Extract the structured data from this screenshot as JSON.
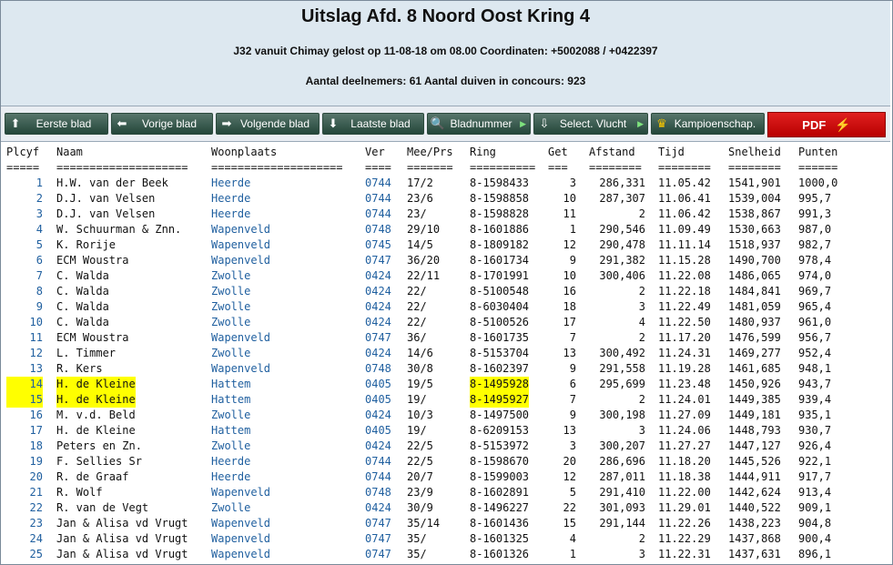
{
  "header": {
    "title": "Uitslag Afd. 8 Noord Oost Kring 4",
    "subtitle1": "J32 vanuit Chimay gelost op 11-08-18 om 08.00 Coordinaten: +5002088 / +0422397",
    "subtitle2": "Aantal deelnemers: 61 Aantal duiven in concours: 923"
  },
  "toolbar": {
    "first": "Eerste blad",
    "prev": "Vorige blad",
    "next": "Volgende blad",
    "last": "Laatste blad",
    "number": "Bladnummer",
    "select": "Select. Vlucht",
    "champ": "Kampioenschap.",
    "pdf": "PDF"
  },
  "table": {
    "headers": [
      "Plcyf",
      "Naam",
      "Woonplaats",
      "Ver",
      "Mee/Prs",
      "Ring",
      "Get",
      "Afstand",
      "Tijd",
      "Snelheid",
      "Punten"
    ],
    "underlines": [
      "=====",
      "====================",
      "====================",
      "====",
      "=======",
      "==========",
      "===",
      "========",
      "========",
      "========",
      "======"
    ],
    "rows": [
      [
        "1",
        "H.W. van der Beek",
        "Heerde",
        "0744",
        "17/2",
        "8-1598433",
        "3",
        "286,331",
        "11.05.42",
        "1541,901",
        "1000,0"
      ],
      [
        "2",
        "D.J. van Velsen",
        "Heerde",
        "0744",
        "23/6",
        "8-1598858",
        "10",
        "287,307",
        "11.06.41",
        "1539,004",
        "995,7"
      ],
      [
        "3",
        "D.J. van Velsen",
        "Heerde",
        "0744",
        "23/",
        "8-1598828",
        "11",
        "2",
        "11.06.42",
        "1538,867",
        "991,3"
      ],
      [
        "4",
        "W. Schuurman & Znn.",
        "Wapenveld",
        "0748",
        "29/10",
        "8-1601886",
        "1",
        "290,546",
        "11.09.49",
        "1530,663",
        "987,0"
      ],
      [
        "5",
        "K. Rorije",
        "Wapenveld",
        "0745",
        "14/5",
        "8-1809182",
        "12",
        "290,478",
        "11.11.14",
        "1518,937",
        "982,7"
      ],
      [
        "6",
        "ECM Woustra",
        "Wapenveld",
        "0747",
        "36/20",
        "8-1601734",
        "9",
        "291,382",
        "11.15.28",
        "1490,700",
        "978,4"
      ],
      [
        "7",
        "C. Walda",
        "Zwolle",
        "0424",
        "22/11",
        "8-1701991",
        "10",
        "300,406",
        "11.22.08",
        "1486,065",
        "974,0"
      ],
      [
        "8",
        "C. Walda",
        "Zwolle",
        "0424",
        "22/",
        "8-5100548",
        "16",
        "2",
        "11.22.18",
        "1484,841",
        "969,7"
      ],
      [
        "9",
        "C. Walda",
        "Zwolle",
        "0424",
        "22/",
        "8-6030404",
        "18",
        "3",
        "11.22.49",
        "1481,059",
        "965,4"
      ],
      [
        "10",
        "C. Walda",
        "Zwolle",
        "0424",
        "22/",
        "8-5100526",
        "17",
        "4",
        "11.22.50",
        "1480,937",
        "961,0"
      ],
      [
        "11",
        "ECM Woustra",
        "Wapenveld",
        "0747",
        "36/",
        "8-1601735",
        "7",
        "2",
        "11.17.20",
        "1476,599",
        "956,7"
      ],
      [
        "12",
        "L. Timmer",
        "Zwolle",
        "0424",
        "14/6",
        "8-5153704",
        "13",
        "300,492",
        "11.24.31",
        "1469,277",
        "952,4"
      ],
      [
        "13",
        "R. Kers",
        "Wapenveld",
        "0748",
        "30/8",
        "8-1602397",
        "9",
        "291,558",
        "11.19.28",
        "1461,685",
        "948,1"
      ],
      [
        "14",
        "H. de Kleine",
        "Hattem",
        "0405",
        "19/5",
        "8-1495928",
        "6",
        "295,699",
        "11.23.48",
        "1450,926",
        "943,7"
      ],
      [
        "15",
        "H. de Kleine",
        "Hattem",
        "0405",
        "19/",
        "8-1495927",
        "7",
        "2",
        "11.24.01",
        "1449,385",
        "939,4"
      ],
      [
        "16",
        "M. v.d. Beld",
        "Zwolle",
        "0424",
        "10/3",
        "8-1497500",
        "9",
        "300,198",
        "11.27.09",
        "1449,181",
        "935,1"
      ],
      [
        "17",
        "H. de Kleine",
        "Hattem",
        "0405",
        "19/",
        "8-6209153",
        "13",
        "3",
        "11.24.06",
        "1448,793",
        "930,7"
      ],
      [
        "18",
        "Peters en Zn.",
        "Zwolle",
        "0424",
        "22/5",
        "8-5153972",
        "3",
        "300,207",
        "11.27.27",
        "1447,127",
        "926,4"
      ],
      [
        "19",
        "F. Sellies Sr",
        "Heerde",
        "0744",
        "22/5",
        "8-1598670",
        "20",
        "286,696",
        "11.18.20",
        "1445,526",
        "922,1"
      ],
      [
        "20",
        "R. de Graaf",
        "Heerde",
        "0744",
        "20/7",
        "8-1599003",
        "12",
        "287,011",
        "11.18.38",
        "1444,911",
        "917,7"
      ],
      [
        "21",
        "R. Wolf",
        "Wapenveld",
        "0748",
        "23/9",
        "8-1602891",
        "5",
        "291,410",
        "11.22.00",
        "1442,624",
        "913,4"
      ],
      [
        "22",
        "R. van de Vegt",
        "Zwolle",
        "0424",
        "30/9",
        "8-1496227",
        "22",
        "301,093",
        "11.29.01",
        "1440,522",
        "909,1"
      ],
      [
        "23",
        "Jan & Alisa vd Vrugt",
        "Wapenveld",
        "0747",
        "35/14",
        "8-1601436",
        "15",
        "291,144",
        "11.22.26",
        "1438,223",
        "904,8"
      ],
      [
        "24",
        "Jan & Alisa vd Vrugt",
        "Wapenveld",
        "0747",
        "35/",
        "8-1601325",
        "4",
        "2",
        "11.22.29",
        "1437,868",
        "900,4"
      ],
      [
        "25",
        "Jan & Alisa vd Vrugt",
        "Wapenveld",
        "0747",
        "35/",
        "8-1601326",
        "1",
        "3",
        "11.22.31",
        "1437,631",
        "896,1"
      ]
    ],
    "highlight_rows": [
      13,
      14
    ],
    "colors": {
      "link": "#1f5f9f",
      "highlight": "#ffff00"
    }
  }
}
